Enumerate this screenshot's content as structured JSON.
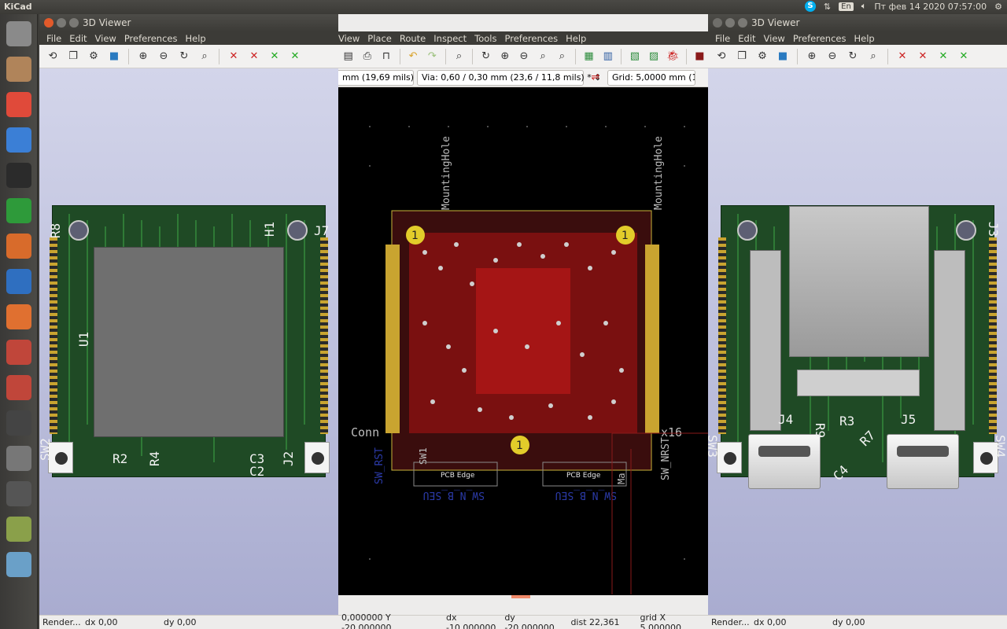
{
  "topbar": {
    "app_name": "KiCad",
    "language": "En",
    "datetime": "Пт фев 14 2020 07:57:00"
  },
  "launcher": {
    "items": [
      {
        "name": "ubuntu-home-icon",
        "color": "#8a8a8a"
      },
      {
        "name": "files-icon",
        "color": "#b0845a"
      },
      {
        "name": "chrome-icon",
        "color": "#e04a3a"
      },
      {
        "name": "chromium-icon",
        "color": "#3b7fd6"
      },
      {
        "name": "terminal-icon",
        "color": "#2b2b2b"
      },
      {
        "name": "calc-icon",
        "color": "#2e9a3a"
      },
      {
        "name": "impress-icon",
        "color": "#d86b2b"
      },
      {
        "name": "writer-icon",
        "color": "#2f6fc0"
      },
      {
        "name": "software-center-icon",
        "color": "#e07030"
      },
      {
        "name": "kicad-icon",
        "color": "#c0463a"
      },
      {
        "name": "system-settings-icon",
        "color": "#c0463a"
      },
      {
        "name": "webcam-icon",
        "color": "#444"
      },
      {
        "name": "help-icon",
        "color": "#777"
      },
      {
        "name": "calculator-icon",
        "color": "#555"
      },
      {
        "name": "monkey-icon",
        "color": "#8aa04a"
      },
      {
        "name": "workspace-icon",
        "color": "#6aa0c8"
      }
    ]
  },
  "left_window": {
    "title": "3D Viewer",
    "menu": [
      "File",
      "Edit",
      "View",
      "Preferences",
      "Help"
    ],
    "status": {
      "render": "Render...",
      "dx": "dx 0,00",
      "dy": "dy 0,00"
    },
    "silk": [
      "R8",
      "H1",
      "J7",
      "U1",
      "R2",
      "R4",
      "C3",
      "C2",
      "J2",
      "SW1",
      "SW2"
    ]
  },
  "middle_window": {
    "menu": [
      "View",
      "Place",
      "Route",
      "Inspect",
      "Tools",
      "Preferences",
      "Help"
    ],
    "track_combo": "mm (19,69 mils)",
    "via_combo": "Via: 0,60 / 0,30 mm (23,6 / 11,8 mils) *",
    "grid_combo": "Grid: 5,0000 mm (196",
    "labels": [
      "MountingHole",
      "MountingHole",
      "Conn",
      "x16",
      "PCB Edge",
      "PCB Edge",
      "SW_N_B_SEU",
      "SW_N_B_SEU",
      "SW_RST",
      "SW1",
      "SW_NRST",
      "Ma"
    ],
    "pad_number": "1",
    "status": {
      "xy": "0,000000  Y -20,000000",
      "dx": "dx -10,000000",
      "dy": "dy -20,000000",
      "dist": "dist 22,361",
      "grid": "grid X 5,000000"
    }
  },
  "right_window": {
    "title": "3D Viewer",
    "menu": [
      "File",
      "Edit",
      "View",
      "Preferences",
      "Help"
    ],
    "status": {
      "render": "Render...",
      "dx": "dx 0,00",
      "dy": "dy 0,00"
    },
    "silk": [
      "J4",
      "R9",
      "R3",
      "R7",
      "J5",
      "C4",
      "J3",
      "SW3",
      "SW4"
    ]
  }
}
